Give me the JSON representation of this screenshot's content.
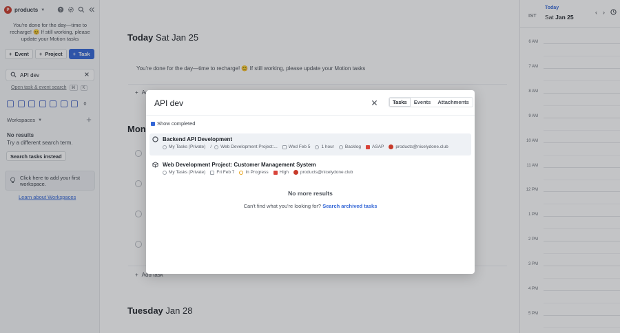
{
  "sidebar": {
    "workspace_initial": "P",
    "workspace_name": "products",
    "done_message": "You're done for the day—time to recharge! 😊 If still working, please update your Motion tasks",
    "event_button": "Event",
    "project_button": "Project",
    "task_button": "Task",
    "search_value": "API dev",
    "advanced_search_link": "Open task & event search",
    "shortcut_key_1": "⌘",
    "shortcut_key_2": "K",
    "view_count": "0",
    "workspaces_label": "Workspaces",
    "no_results_title": "No results",
    "no_results_hint": "Try a different search term.",
    "search_tasks_instead": "Search tasks instead",
    "workspace_promo": "Click here to add your first workspace.",
    "learn_workspaces": "Learn about Workspaces"
  },
  "main": {
    "today_prefix": "Today",
    "today_date": "Sat Jan 25",
    "today_message": "You're done for the day—time to recharge! 😊 If still working, please update your Motion tasks",
    "add_task_label": "Add task",
    "monday_partial": "Mond",
    "tuesday_prefix": "Tuesday",
    "tuesday_date": "Jan 28"
  },
  "calendar": {
    "timezone": "IST",
    "today_label": "Today",
    "day_name": "Sat",
    "day_date": "Jan 25",
    "hours": [
      "6 AM",
      "7 AM",
      "8 AM",
      "9 AM",
      "10 AM",
      "11 AM",
      "12 PM",
      "1 PM",
      "2 PM",
      "3 PM",
      "4 PM",
      "5 PM"
    ]
  },
  "modal": {
    "query": "API dev",
    "tabs": [
      "Tasks",
      "Events",
      "Attachments"
    ],
    "active_tab": "Tasks",
    "show_completed_label": "Show completed",
    "results": [
      {
        "title": "Backend API Development",
        "workspace": "My Tasks (Private)",
        "separator": "/",
        "project": "Web Development Project:...",
        "date": "Wed Feb 5",
        "duration": "1 hour",
        "status": "Backlog",
        "priority": "ASAP",
        "assignee": "products@nicelydone.club"
      },
      {
        "title": "Web Development Project: Customer Management System",
        "workspace": "My Tasks (Private)",
        "date": "Fri Feb 7",
        "status": "In Progress",
        "priority": "High",
        "assignee": "products@nicelydone.club"
      }
    ],
    "no_more_results": "No more results",
    "cant_find_text": "Can't find what you're looking for?",
    "search_archived_link": "Search archived tasks"
  },
  "colors": {
    "accent": "#3366d6",
    "workspace_badge": "#c73a2a",
    "priority_flag": "#d8443a",
    "in_progress": "#e8a51d"
  }
}
